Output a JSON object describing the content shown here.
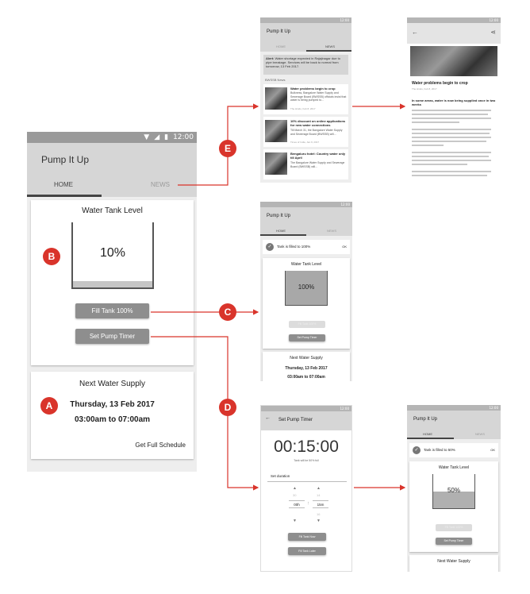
{
  "status": {
    "time": "12:00",
    "time_small": "12:00"
  },
  "app": {
    "title": "Pump It Up",
    "tab_home": "HOME",
    "tab_news": "NEWS"
  },
  "main": {
    "tank_title": "Water Tank Level",
    "tank_percent": "10%",
    "tank_fill": 0.1,
    "fill_button": "Fill Tank 100%",
    "timer_button": "Set Pump Timer",
    "next_supply_title": "Next Water Supply",
    "next_supply_date": "Thursday, 13 Feb 2017",
    "next_supply_time": "03:00am to 07:00am",
    "schedule_link": "Get Full Schedule"
  },
  "badges": {
    "a": "A",
    "b": "B",
    "c": "C",
    "d": "D",
    "e": "E"
  },
  "news": {
    "alert_label": "Alert:",
    "alert_text": "Water shortage expected in Rajajinagar due to pipe breakage. Services will be back to normal from tomorrow, 13 Feb 2017.",
    "section": "BWSSB News",
    "items": [
      {
        "title": "Water problems begin to crop",
        "body": "Bulkness, Bangalore Water Supply and Sewerage Board (BWSSB) officials insist that water is being pumped to...",
        "date": "The Hindu, Feb 8, 2017"
      },
      {
        "title": "10% discount on online applications for new water connections",
        "body": "Till March 31, the Bangalore Water Supply and Sewerage Board (BWSSB) will...",
        "date": "Times of India, Jan 9, 2017"
      },
      {
        "title": "Bengaluru hotel: Country water only till April",
        "body": "The Bangalore Water Supply and Sewerage Board (BWSSB) will...",
        "date": ""
      }
    ]
  },
  "article": {
    "title": "Water problems begin to crop",
    "meta": "The Hindu, Feb 8, 2017",
    "lead": "In some areas, water is now being supplied once in two weeks"
  },
  "filled": {
    "snackbar": "Tank is filled to 100%",
    "ok": "OK",
    "percent": "100%",
    "fill": 1.0,
    "fill_button": "Fill Tank 100%",
    "timer_button": "Set Pump Timer",
    "next_title": "Next Water Supply",
    "next_date": "Thursday, 13 Feb 2017",
    "next_time": "03:00am to 07:00am"
  },
  "timer": {
    "title": "Set Pump Timer",
    "time": "00:15:00",
    "caption": "Tank will be 50% full",
    "duration_label": "Set duration",
    "left_prev": "30",
    "left_value": "00h",
    "left_next": "",
    "right_prev": "14",
    "right_value": "15m",
    "right_next": "16",
    "fill_now": "Fill Tank Now",
    "fill_later": "Fill Tank Later"
  },
  "half": {
    "snackbar": "Tank is filled to 50%",
    "ok": "OK",
    "percent": "50%",
    "fill": 0.5,
    "fill_button": "Fill Tank 100%",
    "timer_button": "Set Pump Timer",
    "next_title": "Next Water Supply"
  }
}
